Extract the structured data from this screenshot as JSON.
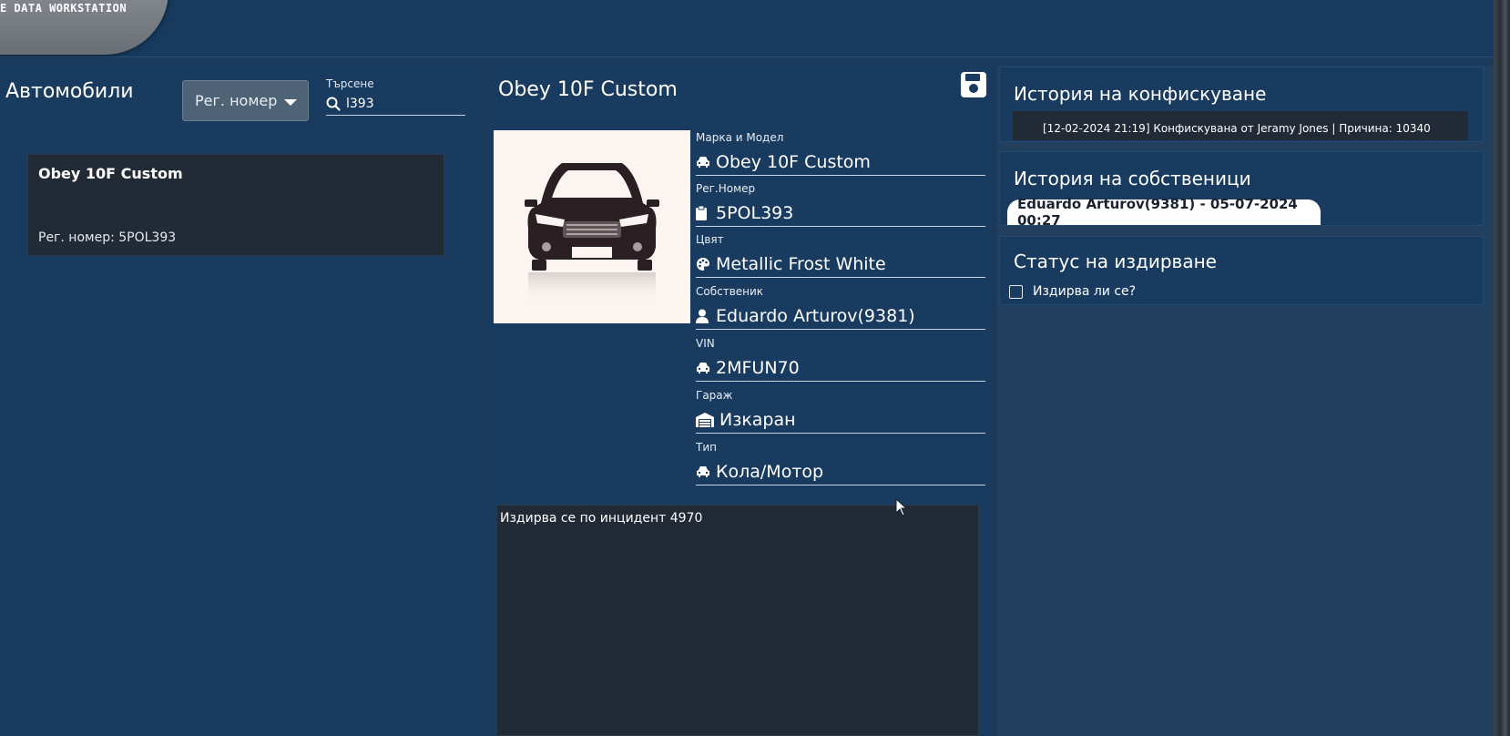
{
  "header": {
    "logo_text": "E DATA WORKSTATION"
  },
  "left_panel": {
    "title": "Автомобили",
    "filter_dropdown": {
      "selected": "Рег. номер"
    },
    "search": {
      "label": "Търсене",
      "value": "l393"
    },
    "results": [
      {
        "title": "Obey 10F Custom",
        "plate": "Рег. номер: 5POL393"
      }
    ]
  },
  "vehicle": {
    "title": "Obey 10F Custom",
    "fields": [
      {
        "label": "Марка и Модел",
        "value": "Obey 10F Custom",
        "icon": "car-icon"
      },
      {
        "label": "Рег.Номер",
        "value": "5POL393",
        "icon": "clipboard-icon"
      },
      {
        "label": "Цвят",
        "value": "Metallic Frost White",
        "icon": "palette-icon"
      },
      {
        "label": "Собственик",
        "value": "Eduardo Arturov(9381)",
        "icon": "user-icon"
      },
      {
        "label": "VIN",
        "value": "2MFUN70",
        "icon": "car-icon"
      },
      {
        "label": "Гараж",
        "value": "Изкаран",
        "icon": "warehouse-icon"
      },
      {
        "label": "Тип",
        "value": "Кола/Мотор",
        "icon": "car-icon"
      }
    ],
    "notes": "Издирва се по инцидент 4970"
  },
  "right_panel": {
    "confiscation": {
      "title": "История на конфискуване",
      "entries": [
        "[12-02-2024 21:19] Конфискувана от Jeramy Jones | Причина: 10340"
      ]
    },
    "owners": {
      "title": "История на собственици",
      "entries": [
        "Eduardo Arturov(9381) - 05-07-2024 00:27"
      ]
    },
    "wanted": {
      "title": "Статус на издирване",
      "checkbox_label": "Издирва ли се?",
      "checked": false
    }
  },
  "colors": {
    "background": "#1c3a5c",
    "panel": "#193b5f",
    "card": "#222a36",
    "dropdown": "#4f6377"
  }
}
